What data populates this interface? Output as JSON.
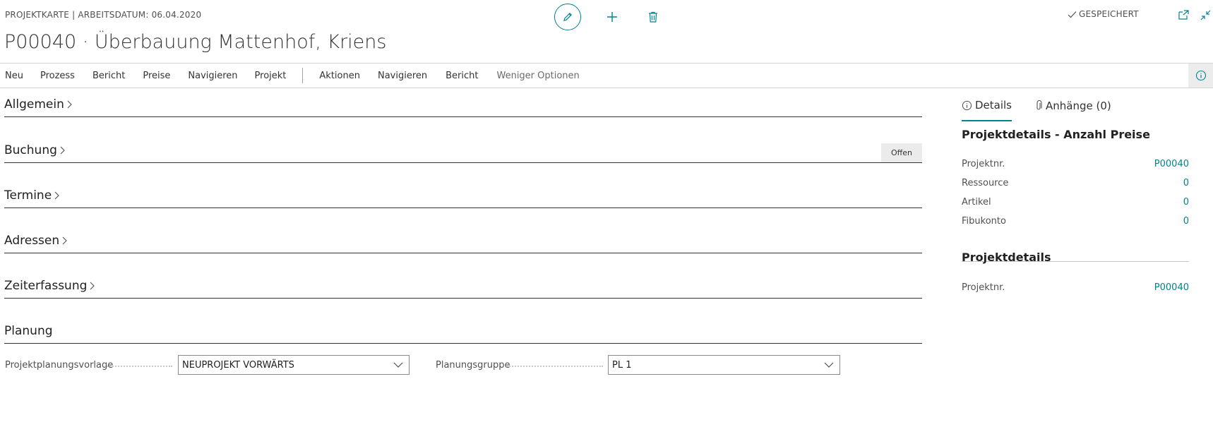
{
  "header": {
    "caption": "PROJEKTKARTE | ARBEITSDATUM: 06.04.2020",
    "title": "P00040 · Überbauung Mattenhof, Kriens",
    "saved_status": "GESPEICHERT"
  },
  "action_bar": {
    "items": [
      "Neu",
      "Prozess",
      "Bericht",
      "Preise",
      "Navigieren",
      "Projekt"
    ],
    "secondary_items": [
      "Aktionen",
      "Navigieren",
      "Bericht"
    ],
    "less_options": "Weniger Optionen"
  },
  "sections": {
    "allgemein": "Allgemein",
    "buchung": "Buchung",
    "buchung_badge": "Offen",
    "termine": "Termine",
    "adressen": "Adressen",
    "zeiterfassung": "Zeiterfassung",
    "planung": "Planung"
  },
  "planung": {
    "template_label": "Projektplanungsvorlage",
    "template_value": "NEUPROJEKT VORWÄRTS",
    "group_label": "Planungsgruppe",
    "group_value": "PL 1"
  },
  "factbox": {
    "tabs": {
      "details": "Details",
      "attachments": "Anhänge (0)"
    },
    "price_heading": "Projektdetails - Anzahl Preise",
    "price_rows": [
      {
        "label": "Projektnr.",
        "value": "P00040"
      },
      {
        "label": "Ressource",
        "value": "0"
      },
      {
        "label": "Artikel",
        "value": "0"
      },
      {
        "label": "Fibukonto",
        "value": "0"
      }
    ],
    "details_heading": "Projektdetails",
    "details_rows": [
      {
        "label": "Projektnr.",
        "value": "P00040"
      }
    ]
  },
  "colors": {
    "accent": "#00838f",
    "text": "#212121",
    "muted": "#505050"
  }
}
